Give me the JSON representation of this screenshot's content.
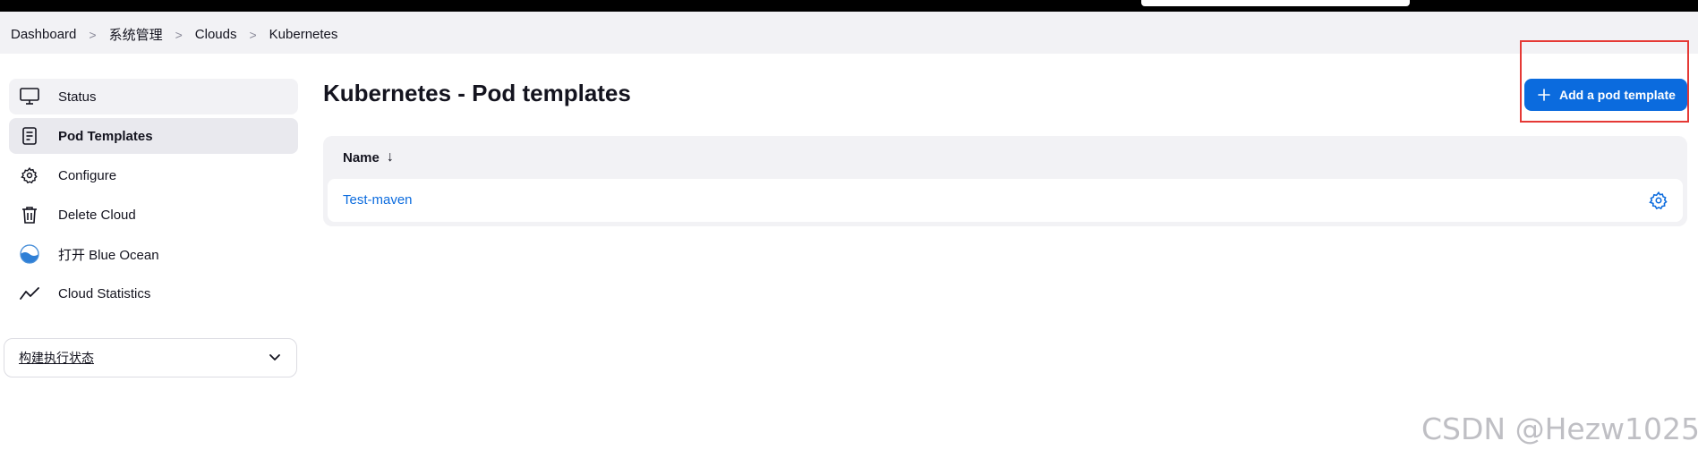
{
  "breadcrumb": [
    {
      "label": "Dashboard"
    },
    {
      "label": "系统管理"
    },
    {
      "label": "Clouds"
    },
    {
      "label": "Kubernetes"
    }
  ],
  "sidebar": {
    "items": [
      {
        "label": "Status",
        "icon": "monitor-icon"
      },
      {
        "label": "Pod Templates",
        "icon": "document-icon"
      },
      {
        "label": "Configure",
        "icon": "gear-icon"
      },
      {
        "label": "Delete Cloud",
        "icon": "trash-icon"
      },
      {
        "label": "打开 Blue Ocean",
        "icon": "blue-ocean-icon"
      },
      {
        "label": "Cloud Statistics",
        "icon": "line-chart-icon"
      }
    ]
  },
  "build_executor": {
    "label": "构建执行状态"
  },
  "page": {
    "title": "Kubernetes - Pod templates"
  },
  "actions": {
    "add_label": "Add a pod template"
  },
  "table": {
    "header_name": "Name",
    "sort_indicator": "↓",
    "rows": [
      {
        "name": "Test-maven"
      }
    ]
  },
  "watermark": "CSDN @Hezw1025",
  "colors": {
    "accent": "#0b6bde",
    "highlight": "#e53935"
  }
}
